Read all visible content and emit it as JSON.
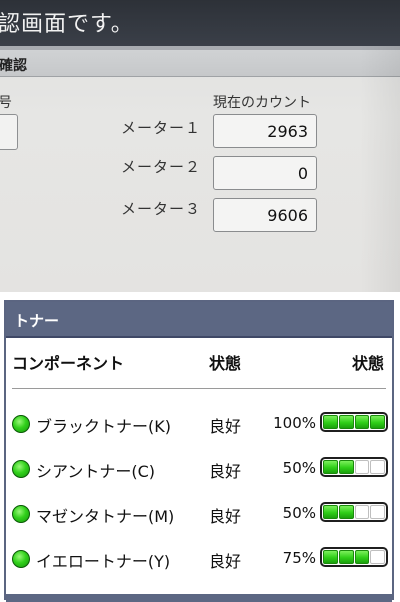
{
  "photo": {
    "header_text": "認画面です。",
    "subheader_text": "確認",
    "left_column_label": "号",
    "right_column_label": "現在のカウント",
    "meters": [
      {
        "label": "メーター１",
        "value": "2963"
      },
      {
        "label": "メーター２",
        "value": "0"
      },
      {
        "label": "メーター３",
        "value": "9606"
      }
    ]
  },
  "toner_panel": {
    "title": "トナー",
    "columns": {
      "component": "コンポーネント",
      "status": "状態",
      "status2": "状態"
    },
    "items": [
      {
        "name": "ブラックトナー(K)",
        "status": "良好",
        "percent": "100%",
        "level": 1.0,
        "led_icon": "green-led-icon"
      },
      {
        "name": "シアントナー(C)",
        "status": "良好",
        "percent": "50%",
        "level": 0.5,
        "led_icon": "green-led-icon"
      },
      {
        "name": "マゼンタトナー(M)",
        "status": "良好",
        "percent": "50%",
        "level": 0.5,
        "led_icon": "green-led-icon"
      },
      {
        "name": "イエロートナー(Y)",
        "status": "良好",
        "percent": "75%",
        "level": 0.75,
        "led_icon": "green-led-icon"
      }
    ],
    "colors": {
      "header": "#5c6783",
      "led": "#32d11c",
      "gauge_fill": "#2fcf18"
    }
  }
}
